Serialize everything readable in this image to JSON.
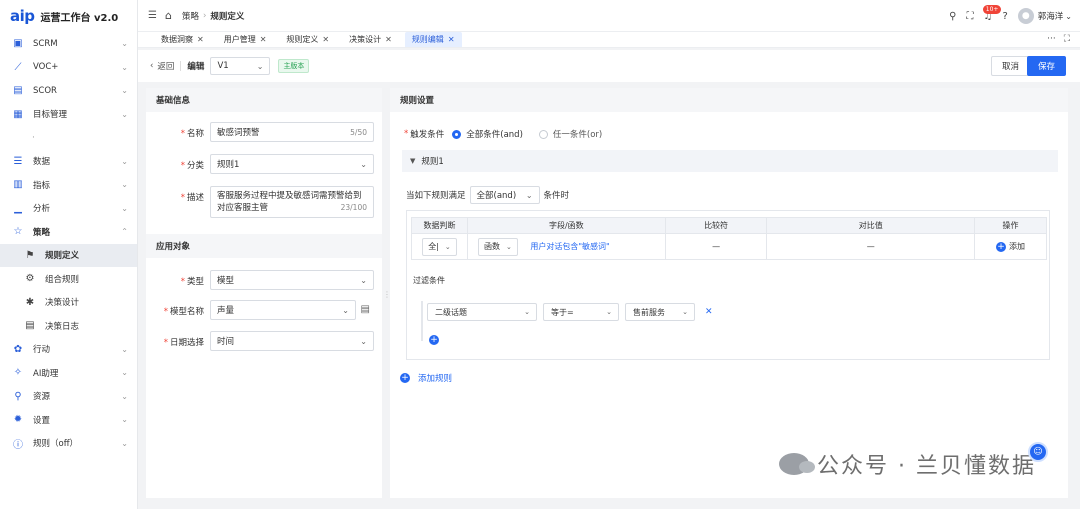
{
  "brand": {
    "logo": "aip",
    "title": "运营工作台 v2.0"
  },
  "nav": [
    {
      "label": "SCRM",
      "icon": "scrm-icon",
      "glyph": "▣"
    },
    {
      "label": "VOC+",
      "icon": "line-chart-icon",
      "glyph": "⟋"
    },
    {
      "label": "SCOR",
      "icon": "monitor-icon",
      "glyph": "▤"
    },
    {
      "label": "目标管理",
      "icon": "target-icon",
      "glyph": "▦"
    },
    {
      "label": "数据",
      "icon": "data-icon",
      "glyph": "☰"
    },
    {
      "label": "指标",
      "icon": "metric-icon",
      "glyph": "▥"
    },
    {
      "label": "分析",
      "icon": "analysis-icon",
      "glyph": "▁"
    },
    {
      "label": "策略",
      "icon": "star-icon",
      "glyph": "☆"
    },
    {
      "label": "规则定义",
      "icon": "rule-def-icon",
      "glyph": "⚑"
    },
    {
      "label": "组合规则",
      "icon": "combine-rule-icon",
      "glyph": "⚙"
    },
    {
      "label": "决策设计",
      "icon": "decision-design-icon",
      "glyph": "✱"
    },
    {
      "label": "决策日志",
      "icon": "log-icon",
      "glyph": "▤"
    },
    {
      "label": "行动",
      "icon": "action-icon",
      "glyph": "✿"
    },
    {
      "label": "AI助理",
      "icon": "ai-icon",
      "glyph": "✧"
    },
    {
      "label": "资源",
      "icon": "resource-icon",
      "glyph": "⚲"
    },
    {
      "label": "设置",
      "icon": "settings-icon",
      "glyph": "✹"
    },
    {
      "label": "规则（off）",
      "icon": "info-icon",
      "glyph": "ⓘ"
    }
  ],
  "nav_dot": "·",
  "header": {
    "breadcrumb": [
      "策略",
      "规则定义"
    ],
    "notification_badge": "10+",
    "username": "郭海洋"
  },
  "tabs": [
    {
      "label": "数据洞察"
    },
    {
      "label": "用户管理"
    },
    {
      "label": "规则定义"
    },
    {
      "label": "决策设计"
    },
    {
      "label": "规则编辑"
    }
  ],
  "toolbar": {
    "back": "返回",
    "edit_label": "编辑",
    "version": "V1",
    "main_tag": "主版本",
    "cancel": "取消",
    "save": "保存"
  },
  "basic_info": {
    "title": "基础信息",
    "name_label": "名称",
    "name_value": "敏感词预警",
    "name_count": "5/50",
    "category_label": "分类",
    "category_value": "规则1",
    "desc_label": "描述",
    "desc_value": "客服服务过程中提及敏感词需预警给到对应客服主管",
    "desc_count": "23/100"
  },
  "apply_target": {
    "title": "应用对象",
    "type_label": "类型",
    "type_value": "模型",
    "model_label": "模型名称",
    "model_value": "声量",
    "date_label": "日期选择",
    "date_value": "时间"
  },
  "rule_settings": {
    "title": "规则设置",
    "trigger_label": "触发条件",
    "opt_all": "全部条件(and)",
    "opt_any": "任一条件(or)",
    "rule_name": "规则1",
    "when_prefix": "当如下规则满足",
    "when_value": "全部(and)",
    "when_suffix": "条件时",
    "table_headers": [
      "数据判断",
      "字段/函数",
      "比较符",
      "对比值",
      "操作"
    ],
    "row": {
      "judge": "全|",
      "func": "函数",
      "field_text": "用户对话包含\"敏感词\"",
      "comparator": "—",
      "compare_value": "—",
      "action": "添加"
    },
    "filter_label": "过滤条件",
    "filter": {
      "field": "二级话题",
      "operator": "等于=",
      "value": "售前服务"
    },
    "add_rule": "添加规则"
  },
  "watermark": "公众号 · 兰贝懂数据"
}
